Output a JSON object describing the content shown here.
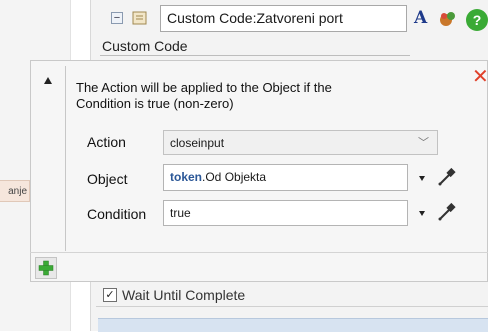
{
  "left_tab": {
    "text": "anje"
  },
  "background_panel": {
    "title_value": "Custom Code:Zatvoreni port",
    "bold_a": "A",
    "help": "?",
    "sublabel": "Custom Code",
    "wait_label": "Wait Until Complete",
    "wait_checked": true
  },
  "popup": {
    "description": "The Action will be applied to the Object if the Condition is true (non-zero)",
    "action": {
      "label": "Action",
      "value": "closeinput"
    },
    "object": {
      "label": "Object",
      "value_keyword": "token",
      "value_rest": ".Od Objekta"
    },
    "condition": {
      "label": "Condition",
      "value": "true"
    },
    "colors": {
      "close": "#e0402a",
      "add": "#3aaa35",
      "keyword": "#2b5797"
    }
  }
}
